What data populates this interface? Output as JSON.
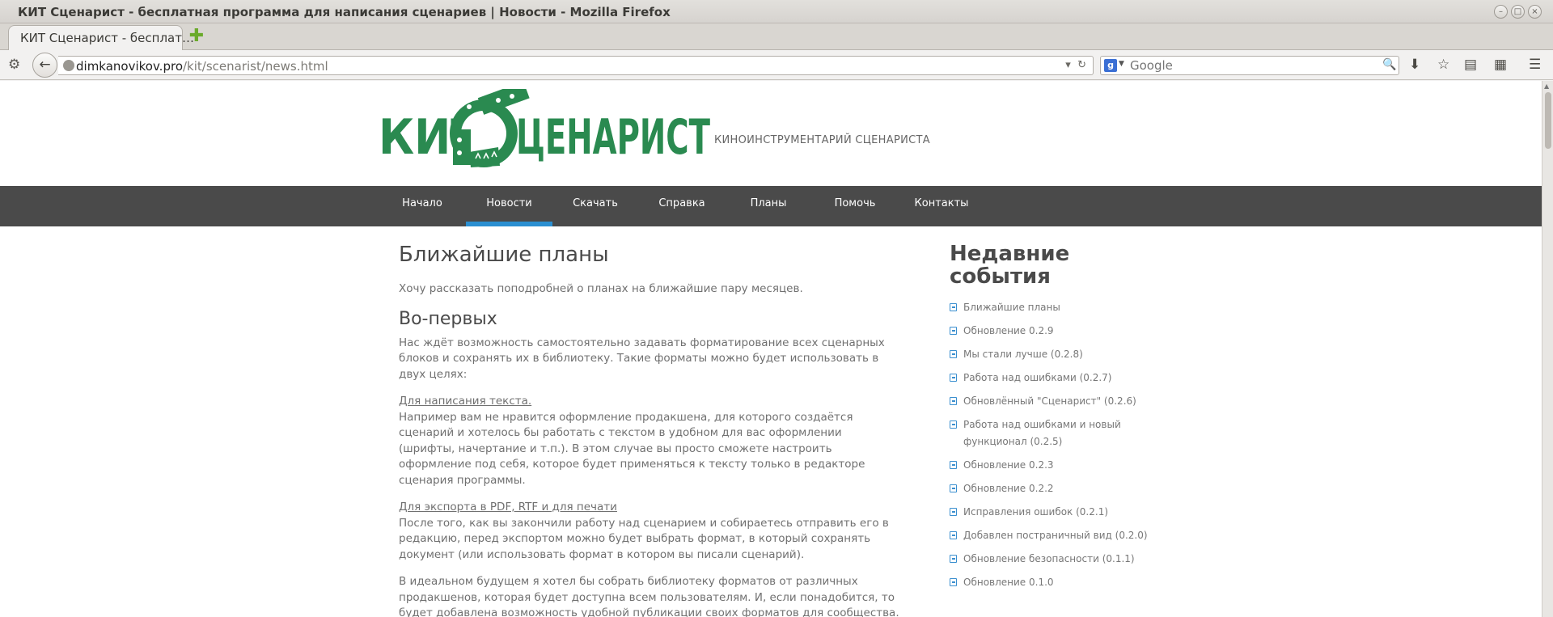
{
  "window": {
    "title": "КИТ Сценарист - бесплатная программа для написания сценариев | Новости - Mozilla Firefox"
  },
  "tab": {
    "label": "КИТ Сценарист - бесплат…"
  },
  "address": {
    "host": "dimkanovikov.pro",
    "path": "/kit/scenarist/news.html"
  },
  "search": {
    "placeholder": "Google",
    "engine": "g"
  },
  "site": {
    "brand_left": "КИТ",
    "brand_right": "ЦЕНАРИСТ",
    "tagline": "КИНОИНСТРУМЕНТАРИЙ СЦЕНАРИСТА",
    "brand_color": "#2a8a50"
  },
  "menu": [
    {
      "label": "Начало"
    },
    {
      "label": "Новости",
      "active": true
    },
    {
      "label": "Скачать"
    },
    {
      "label": "Справка"
    },
    {
      "label": "Планы"
    },
    {
      "label": "Помочь"
    },
    {
      "label": "Контакты"
    }
  ],
  "article": {
    "title": "Ближайшие планы",
    "intro": "Хочу рассказать поподробней о планах на ближайшие пару месяцев.",
    "section1_title": "Во-первых",
    "section1_p1": "Нас ждёт возможность самостоятельно задавать форматирование всех сценарных блоков и сохранять их в библиотеку. Такие форматы можно будет использовать в двух целях:",
    "purpose1_title": "Для написания текста.",
    "purpose1_text": "Например вам не нравится оформление продакшена, для которого создаётся сценарий и хотелось бы работать с текстом в удобном для вас оформлении (шрифты, начертание и т.п.). В этом случае вы просто сможете настроить оформление под себя, которое будет применяться к тексту только в редакторе сценария программы.",
    "purpose2_title": "Для экспорта в PDF, RTF и для печати",
    "purpose2_text": "После того, как вы закончили работу над сценарием и собираетесь отправить его в редакцию, перед экспортом можно будет выбрать формат, в который сохранять документ (или использовать формат в котором вы писали сценарий).",
    "closing": "В идеальном будущем я хотел бы собрать библиотеку форматов от различных продакшенов, которая будет доступна всем пользователям. И, если понадобится, то будет добавлена возможность удобной публикации своих форматов для сообщества."
  },
  "sidebar": {
    "title": "Недавние события",
    "items": [
      "Ближайшие планы",
      "Обновление 0.2.9",
      "Мы стали лучше (0.2.8)",
      "Работа над ошибками (0.2.7)",
      "Обновлённый \"Сценарист\" (0.2.6)",
      "Работа над ошибками и новый функционал (0.2.5)",
      "Обновление 0.2.3",
      "Обновление 0.2.2",
      "Исправления ошибок (0.2.1)",
      "Добавлен постраничный вид (0.2.0)",
      "Обновление безопасности (0.1.1)",
      "Обновление 0.1.0"
    ]
  }
}
